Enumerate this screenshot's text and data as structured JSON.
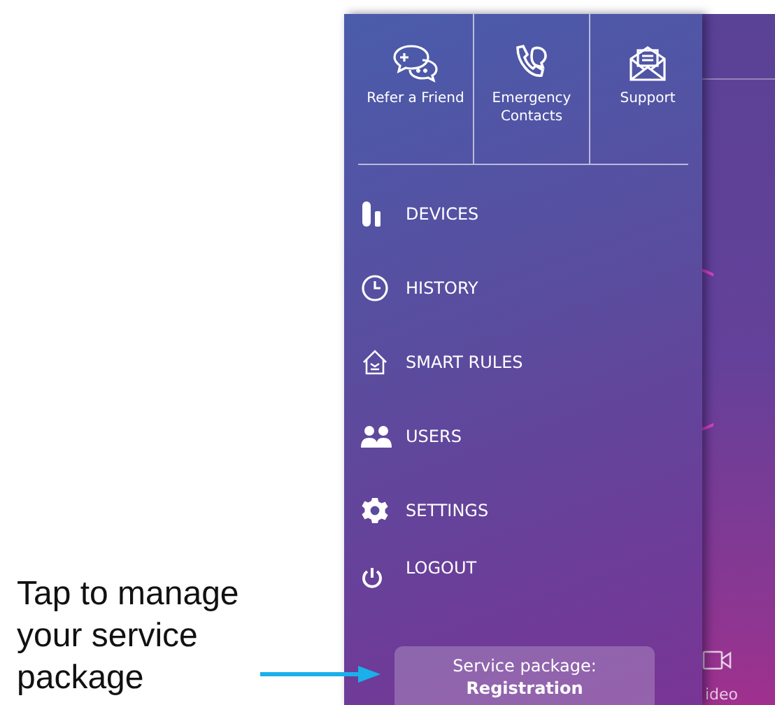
{
  "annotation": {
    "text": "Tap to manage your service package"
  },
  "quick_actions": [
    {
      "kind": "chat",
      "label": "Refer a Friend"
    },
    {
      "kind": "phone",
      "label": "Emergency Contacts"
    },
    {
      "kind": "mail",
      "label": "Support"
    }
  ],
  "menu": [
    {
      "kind": "devices",
      "label": "DEVICES"
    },
    {
      "kind": "history",
      "label": "HISTORY"
    },
    {
      "kind": "rules",
      "label": "SMART RULES"
    },
    {
      "kind": "users",
      "label": "USERS"
    },
    {
      "kind": "settings",
      "label": "SETTINGS"
    },
    {
      "kind": "logout",
      "label": "LOGOUT"
    }
  ],
  "service_package": {
    "label": "Service package:",
    "value": "Registration"
  },
  "background_app": {
    "tab_label": "ideo"
  }
}
